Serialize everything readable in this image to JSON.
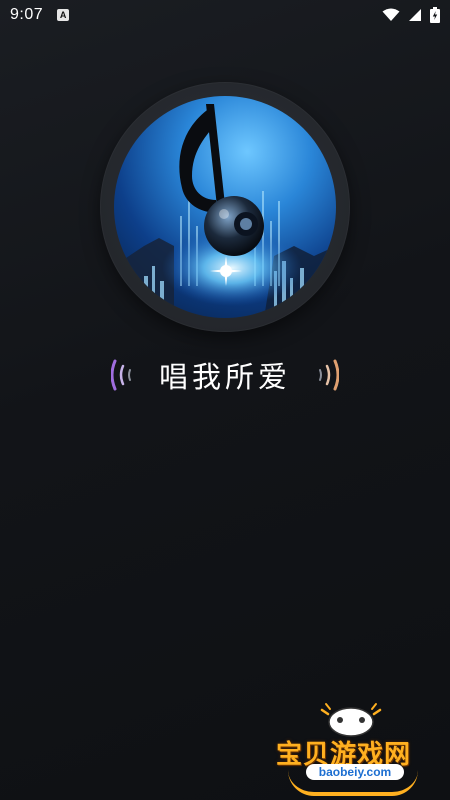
{
  "status_bar": {
    "time": "9:07",
    "notification_icon": "app-a-icon",
    "notification_letter": "A",
    "icons": [
      "wifi-icon",
      "cell-signal-icon",
      "battery-charging-icon"
    ]
  },
  "splash": {
    "logo_icon": "music-note-speaker-icon",
    "slogan": "唱我所爱"
  },
  "watermark": {
    "title": "宝贝游戏网",
    "url": "baobeiy.com"
  },
  "colors": {
    "background": "#121418",
    "disc_ring": "#26292e",
    "accent_blue": "#2a86d8",
    "wave_left": "#a06de0",
    "wave_right": "#e0a070",
    "watermark_orange": "#ffb020"
  }
}
